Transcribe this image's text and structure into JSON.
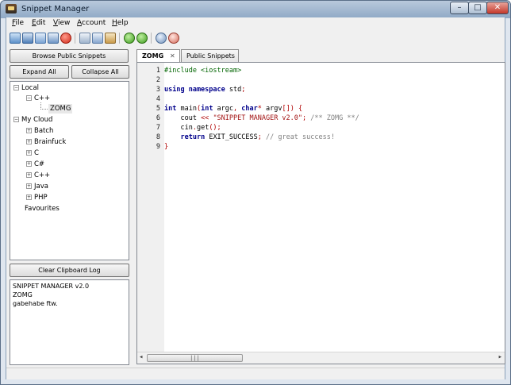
{
  "window": {
    "title": "Snippet Manager",
    "min": "–",
    "max": "□",
    "close": "✕"
  },
  "menu": [
    {
      "label": "File"
    },
    {
      "label": "Edit"
    },
    {
      "label": "View"
    },
    {
      "label": "Account"
    },
    {
      "label": "Help"
    }
  ],
  "toolbar_icons": [
    "new-icon",
    "save-icon",
    "copy-icon",
    "paste-icon",
    "delete-icon",
    "cut-icon",
    "copy2-icon",
    "paste2-icon",
    "undo-icon",
    "redo-icon",
    "find-icon",
    "find-replace-icon"
  ],
  "left": {
    "browse_button": "Browse Public Snippets",
    "expand_all": "Expand All",
    "collapse_all": "Collapse All",
    "tree": [
      {
        "label": "Local",
        "exp": "−"
      },
      {
        "label": "C++",
        "exp": "−"
      },
      {
        "label": "ZOMG",
        "exp": ""
      },
      {
        "label": "My Cloud",
        "exp": "−"
      },
      {
        "label": "Batch",
        "exp": "+"
      },
      {
        "label": "Brainfuck",
        "exp": "+"
      },
      {
        "label": "C",
        "exp": "+"
      },
      {
        "label": "C#",
        "exp": "+"
      },
      {
        "label": "C++",
        "exp": "+"
      },
      {
        "label": "Java",
        "exp": "+"
      },
      {
        "label": "PHP",
        "exp": "+"
      },
      {
        "label": "Favourites",
        "exp": ""
      }
    ],
    "clear_button": "Clear Clipboard Log",
    "clipboard_log": [
      "SNIPPET MANAGER v2.0",
      "ZOMG",
      "gabehabe ftw."
    ]
  },
  "tabs": [
    {
      "label": "ZOMG",
      "close": "✕",
      "active": true
    },
    {
      "label": "Public Snippets",
      "active": false
    }
  ],
  "editor": {
    "line_numbers": [
      "1",
      "2",
      "3",
      "4",
      "5",
      "6",
      "7",
      "8",
      "9"
    ],
    "scroll": {
      "left": "◂",
      "right": "▸",
      "grip": "|||"
    }
  }
}
